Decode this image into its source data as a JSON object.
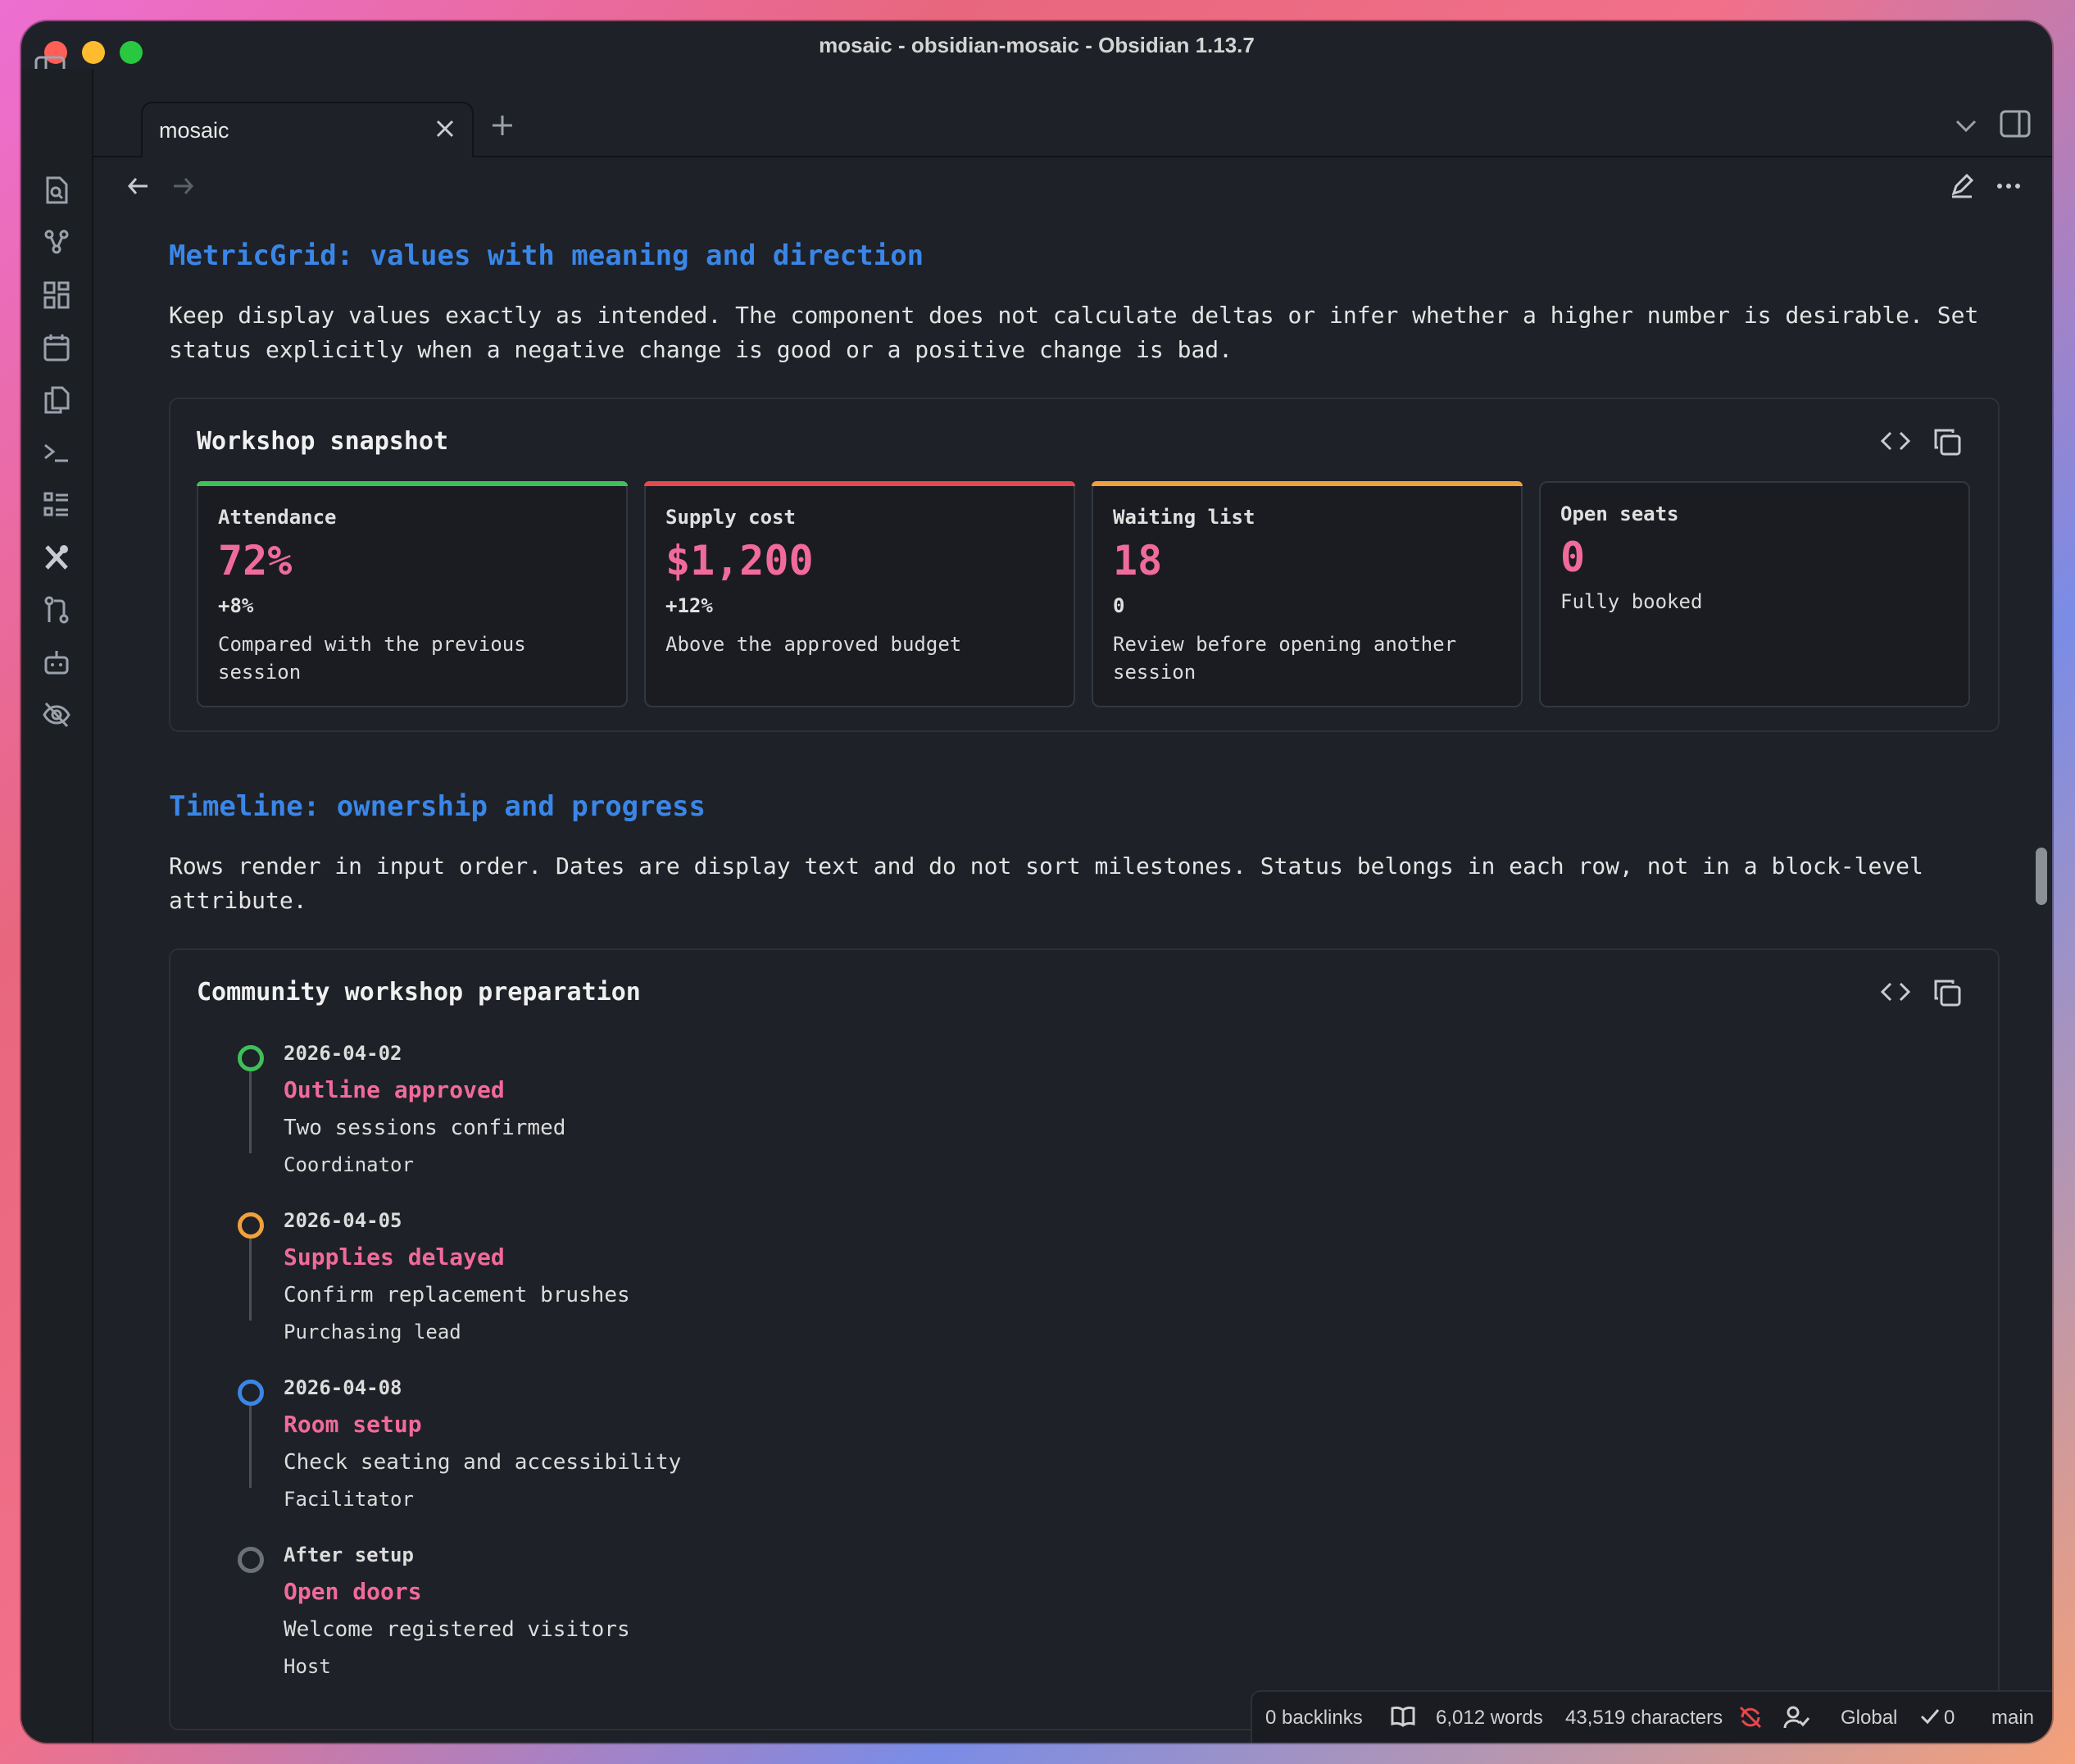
{
  "window": {
    "title": "mosaic - obsidian-mosaic - Obsidian 1.13.7"
  },
  "tab": {
    "label": "mosaic"
  },
  "ribbon_icons": [
    "file-search-icon",
    "graph-icon",
    "dashboard-icon",
    "calendar-icon",
    "copy-icon",
    "terminal-icon",
    "list-icon",
    "tools-icon",
    "git-branch-icon",
    "bot-icon",
    "eye-off-icon"
  ],
  "sections": {
    "metric": {
      "heading": "MetricGrid: values with meaning and direction",
      "paragraph_line1": "Keep display values exactly as intended. The component does not calculate deltas or infer whether a higher number is desirable. Set",
      "paragraph_line2": "status explicitly when a negative change is good or a positive change is bad.",
      "block_title": "Workshop snapshot",
      "cards": [
        {
          "label": "Attendance",
          "value": "72%",
          "delta": "+8%",
          "note": "Compared with the previous session",
          "status_color": "#3fbf5a"
        },
        {
          "label": "Supply cost",
          "value": "$1,200",
          "delta": "+12%",
          "note": "Above the approved budget",
          "status_color": "#e5484d"
        },
        {
          "label": "Waiting list",
          "value": "18",
          "delta": "0",
          "note": "Review before opening another session",
          "status_color": "#f0a03c"
        },
        {
          "label": "Open seats",
          "value": "0",
          "note": "Fully booked"
        }
      ]
    },
    "timeline": {
      "heading": "Timeline: ownership and progress",
      "paragraph_line1": "Rows render in input order. Dates are display text and do not sort milestones. Status belongs in each row, not in a block-level",
      "paragraph_line2": "attribute.",
      "block_title": "Community workshop preparation",
      "items": [
        {
          "date": "2026-04-02",
          "title": "Outline approved",
          "description": "Two sessions confirmed",
          "owner": "Coordinator",
          "status_color": "#3fbf5a"
        },
        {
          "date": "2026-04-05",
          "title": "Supplies delayed",
          "description": "Confirm replacement brushes",
          "owner": "Purchasing lead",
          "status_color": "#f0a03c"
        },
        {
          "date": "2026-04-08",
          "title": "Room setup",
          "description": "Check seating and accessibility",
          "owner": "Facilitator",
          "status_color": "#3a86e8"
        },
        {
          "date": "After setup",
          "title": "Open doors",
          "description": "Welcome registered visitors",
          "owner": "Host",
          "status_color": "#6b7079"
        }
      ]
    }
  },
  "status_bar": {
    "backlinks": "0 backlinks",
    "words": "6,012 words",
    "characters": "43,519 characters",
    "scope": "Global",
    "check_count": "0",
    "branch": "main"
  }
}
